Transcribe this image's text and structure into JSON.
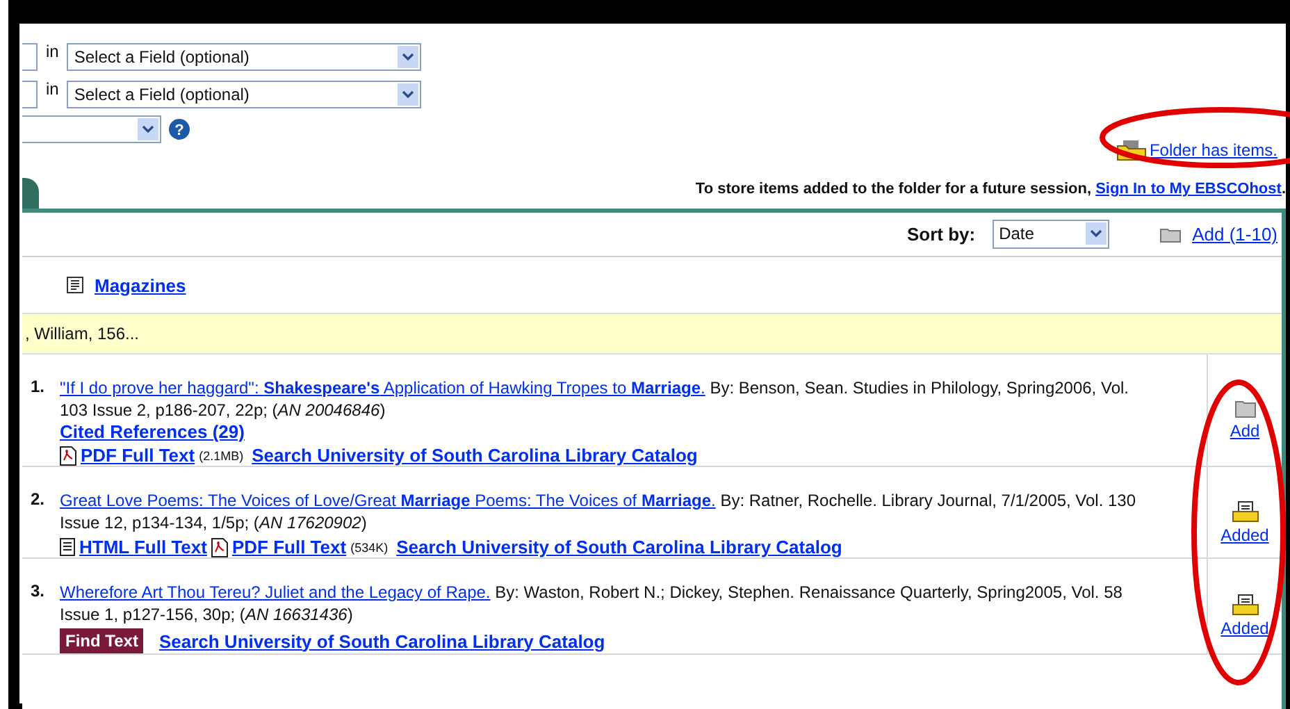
{
  "search_rows": [
    {
      "connector": "in",
      "field": "Select a Field (optional)"
    },
    {
      "connector": "in",
      "field": "Select a Field (optional)"
    }
  ],
  "help_icon": "?",
  "folder_link": "Folder has items.",
  "session_note": {
    "text": "To store items added to the folder for a future session,",
    "link": "Sign In to My EBSCOhost",
    "end": "."
  },
  "sort": {
    "label": "Sort by:",
    "value": "Date"
  },
  "add_all": "Add (1-10)",
  "source_types": [
    {
      "label": "Magazines"
    }
  ],
  "highlight_row": ", William, 156...",
  "results": [
    {
      "number": "1.",
      "title": "\"If I do prove her haggard\": **Shakespeare's** Application of Hawking Tropes to **Marriage**.",
      "citation": "By: Benson, Sean. Studies in Philology, Spring2006, Vol. 103 Issue 2, p186-207, 22p; (*AN 20046846*)",
      "cited_references": "Cited References (29)",
      "links": [
        {
          "kind": "pdf",
          "label": "PDF Full Text",
          "size": "(2.1MB)"
        },
        {
          "kind": "catalog",
          "label": "Search University of South Carolina Library Catalog"
        }
      ],
      "folder": {
        "label": "Add",
        "added": false
      }
    },
    {
      "number": "2.",
      "title": "Great Love Poems: The Voices of Love/Great **Marriage** Poems: The Voices of **Marriage**.",
      "citation": "By: Ratner, Rochelle. Library Journal, 7/1/2005, Vol. 130 Issue 12, p134-134, 1/5p; (*AN 17620902*)",
      "links": [
        {
          "kind": "html",
          "label": "HTML Full Text"
        },
        {
          "kind": "pdf",
          "label": "PDF Full Text",
          "size": "(534K)"
        },
        {
          "kind": "catalog",
          "label": "Search University of South Carolina Library Catalog"
        }
      ],
      "folder": {
        "label": "Added",
        "added": true
      }
    },
    {
      "number": "3.",
      "title": "Wherefore Art Thou Tereu? Juliet and the Legacy of Rape.",
      "citation": "By: Waston, Robert N.; Dickey, Stephen. Renaissance Quarterly, Spring2005, Vol. 58 Issue 1, p127-156, 30p; (*AN 16631436*)",
      "links": [
        {
          "kind": "find_text",
          "label": "Find Text"
        },
        {
          "kind": "catalog",
          "label": "Search University of South Carolina Library Catalog"
        }
      ],
      "folder": {
        "label": "Added",
        "added": true
      }
    }
  ]
}
